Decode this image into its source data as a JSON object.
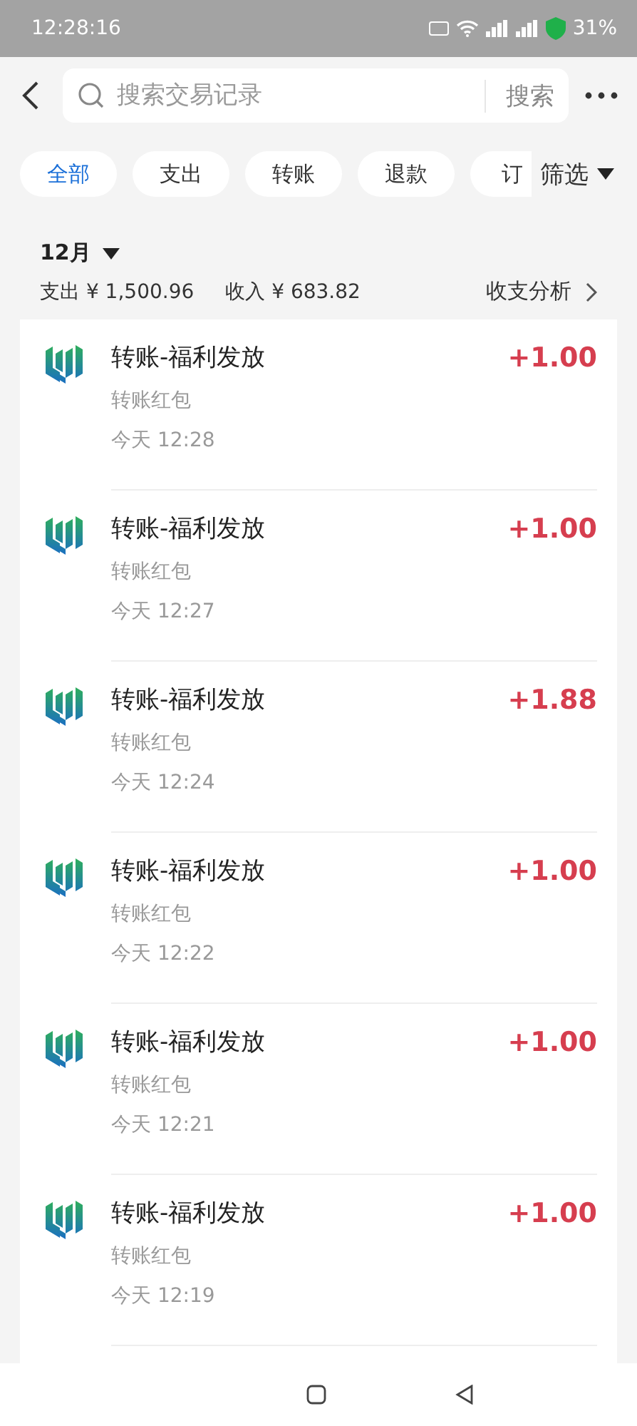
{
  "status_bar": {
    "time": "12:28:16",
    "battery": "31%"
  },
  "search": {
    "placeholder": "搜索交易记录",
    "button": "搜索"
  },
  "chips": [
    {
      "label": "全部",
      "selected": true
    },
    {
      "label": "支出",
      "selected": false
    },
    {
      "label": "转账",
      "selected": false
    },
    {
      "label": "退款",
      "selected": false
    },
    {
      "label": "订",
      "selected": false
    }
  ],
  "filter": "筛选",
  "month": "12月",
  "summary": {
    "expense": "支出 ¥ 1,500.96",
    "income": "收入 ¥ 683.82",
    "analysis": "收支分析"
  },
  "transactions": [
    {
      "title": "转账-福利发放",
      "subtitle": "转账红包",
      "time": "今天 12:28",
      "amount": "+1.00"
    },
    {
      "title": "转账-福利发放",
      "subtitle": "转账红包",
      "time": "今天 12:27",
      "amount": "+1.00"
    },
    {
      "title": "转账-福利发放",
      "subtitle": "转账红包",
      "time": "今天 12:24",
      "amount": "+1.88"
    },
    {
      "title": "转账-福利发放",
      "subtitle": "转账红包",
      "time": "今天 12:22",
      "amount": "+1.00"
    },
    {
      "title": "转账-福利发放",
      "subtitle": "转账红包",
      "time": "今天 12:21",
      "amount": "+1.00"
    },
    {
      "title": "转账-福利发放",
      "subtitle": "转账红包",
      "time": "今天 12:19",
      "amount": "+1.00"
    }
  ]
}
